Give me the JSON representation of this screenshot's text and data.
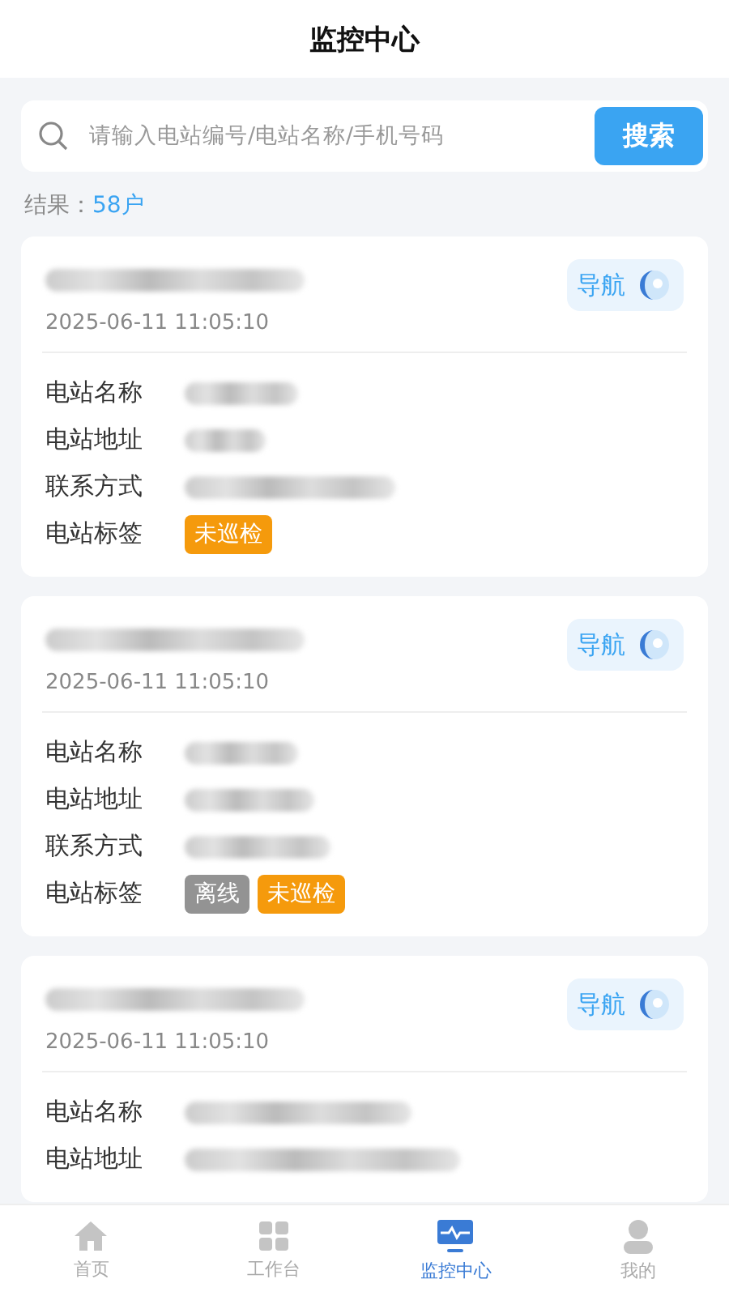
{
  "header": {
    "title": "监控中心"
  },
  "search": {
    "placeholder": "请输入电站编号/电站名称/手机号码",
    "button": "搜索"
  },
  "result": {
    "label": "结果：",
    "count": "58户"
  },
  "stations": [
    {
      "title_redacted": true,
      "time": "2025-06-11 11:05:10",
      "nav": "导航",
      "fields": [
        {
          "label": "电站名称",
          "redacted": true
        },
        {
          "label": "电站地址",
          "redacted": true
        },
        {
          "label": "联系方式",
          "redacted": true
        }
      ],
      "tags_label": "电站标签",
      "tags": [
        {
          "text": "未巡检",
          "color": "#f59a0c"
        }
      ]
    },
    {
      "title_redacted": true,
      "time": "2025-06-11 11:05:10",
      "nav": "导航",
      "fields": [
        {
          "label": "电站名称",
          "redacted": true
        },
        {
          "label": "电站地址",
          "redacted": true
        },
        {
          "label": "联系方式",
          "redacted": true
        }
      ],
      "tags_label": "电站标签",
      "tags": [
        {
          "text": "离线",
          "color": "#939393"
        },
        {
          "text": "未巡检",
          "color": "#f59a0c"
        }
      ]
    },
    {
      "title_redacted": true,
      "time": "2025-06-11 11:05:10",
      "nav": "导航",
      "fields": [
        {
          "label": "电站名称",
          "redacted": true
        },
        {
          "label": "电站地址",
          "redacted": true
        }
      ]
    }
  ],
  "tabbar": [
    {
      "label": "首页",
      "kind": "home",
      "selected": false
    },
    {
      "label": "工作台",
      "kind": "grid",
      "selected": false
    },
    {
      "label": "监控中心",
      "kind": "monitor",
      "selected": true
    },
    {
      "label": "我的",
      "kind": "person",
      "selected": false
    }
  ]
}
